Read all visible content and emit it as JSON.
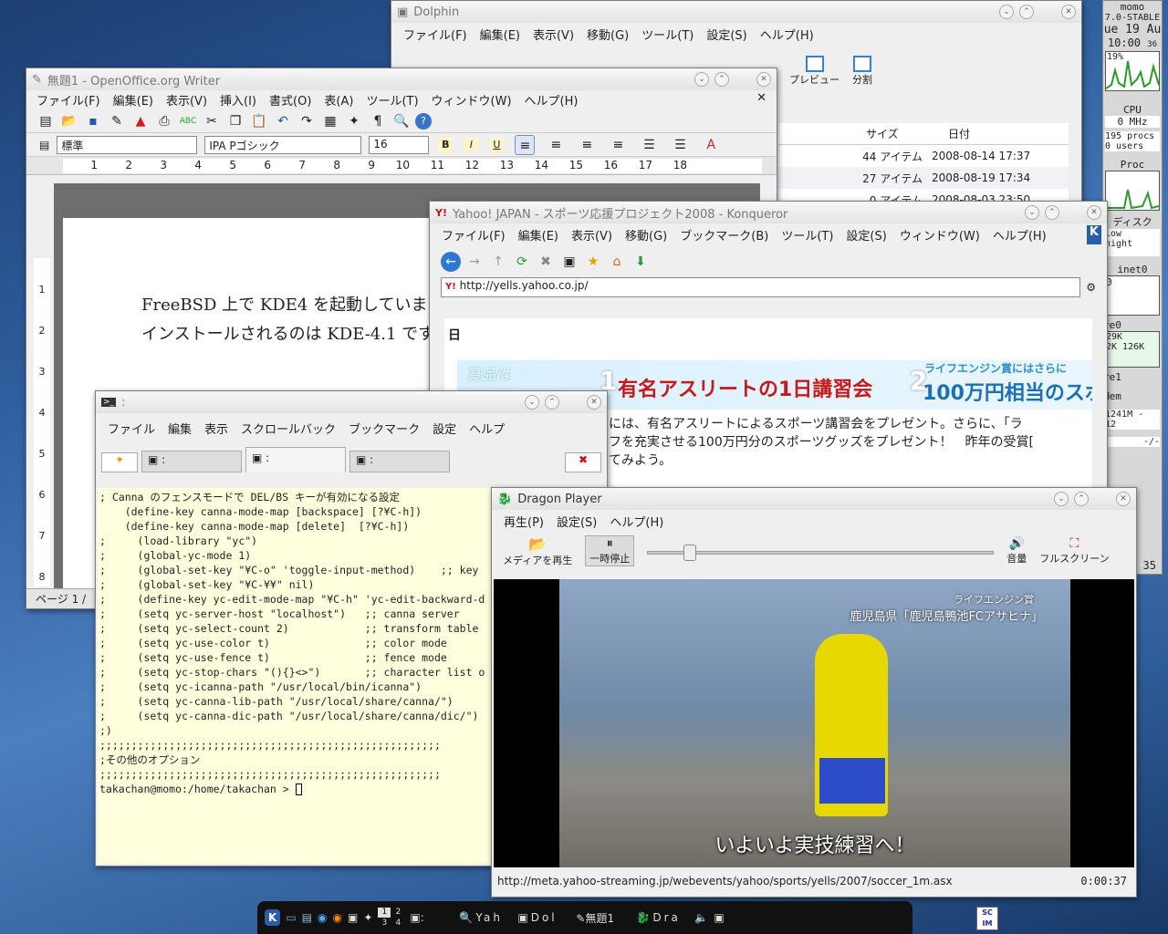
{
  "dolphin": {
    "title": "Dolphin",
    "menu": [
      "ファイル(F)",
      "編集(E)",
      "表示(V)",
      "移動(G)",
      "ツール(T)",
      "設定(S)",
      "ヘルプ(H)"
    ],
    "tools": [
      "プレビュー",
      "分割"
    ],
    "col_size": "サイズ",
    "col_date": "日付",
    "rows": [
      {
        "size": "44 アイテム",
        "date": "2008-08-14 17:37"
      },
      {
        "size": "27 アイテム",
        "date": "2008-08-19 17:34"
      },
      {
        "size": "0 アイテム",
        "date": "2008-08-03 23:50"
      }
    ]
  },
  "writer": {
    "title": "無題1 - OpenOffice.org Writer",
    "menu": [
      "ファイル(F)",
      "編集(E)",
      "表示(V)",
      "挿入(I)",
      "書式(O)",
      "表(A)",
      "ツール(T)",
      "ウィンドウ(W)",
      "ヘルプ(H)"
    ],
    "style": "標準",
    "font": "IPA Pゴシック",
    "size": "16",
    "ruler": [
      "1",
      "2",
      "3",
      "4",
      "5",
      "6",
      "7",
      "8",
      "9",
      "10",
      "11",
      "12",
      "13",
      "14",
      "15",
      "16",
      "17",
      "18"
    ],
    "vruler": [
      "1",
      "2",
      "3",
      "4",
      "5",
      "6",
      "7",
      "8"
    ],
    "line1": "FreeBSD 上で KDE4 を起動していま",
    "line2": "インストールされるのは KDE-4.1 です",
    "status": "ページ 1 /"
  },
  "konqueror": {
    "title": "Yahoo! JAPAN - スポーツ応援プロジェクト2008 - Konqueror",
    "menu": [
      "ファイル(F)",
      "編集(E)",
      "表示(V)",
      "移動(G)",
      "ブックマーク(B)",
      "ツール(T)",
      "設定(S)",
      "ウィンドウ(W)",
      "ヘルプ(H)"
    ],
    "url": "http://yells.yahoo.co.jp/",
    "day": "日",
    "banner_left": "賞品は",
    "banner_num1": "1",
    "banner_main": "有名アスリートの1日講習会",
    "banner_num2": "2",
    "banner_small": "ライフエンジン賞にはさらに",
    "banner_right": "100万円相当のスポ",
    "body1": "には、有名アスリートによるスポーツ講習会をプレゼント。さらに、「ラ",
    "body2": "フを充実させる100万円分のスポーツグッズをプレゼント！　昨年の受賞[",
    "body3": "てみよう。"
  },
  "konsole": {
    "title": ":",
    "menu": [
      "ファイル",
      "編集",
      "表示",
      "スクロールバック",
      "ブックマーク",
      "設定",
      "ヘルプ"
    ],
    "tabs": [
      ":",
      ":",
      ":"
    ],
    "lines": [
      "; Canna のフェンスモードで DEL/BS キーが有効になる設定",
      "    (define-key canna-mode-map [backspace] [?¥C-h])",
      "    (define-key canna-mode-map [delete]  [?¥C-h])",
      "",
      ";     (load-library \"yc\")",
      ";     (global-yc-mode 1)",
      ";     (global-set-key \"¥C-o\" 'toggle-input-method)    ;; key",
      ";     (global-set-key \"¥C-¥¥\" nil)",
      ";     (define-key yc-edit-mode-map \"¥C-h\" 'yc-edit-backward-d",
      ";     (setq yc-server-host \"localhost\")   ;; canna server",
      ";     (setq yc-select-count 2)            ;; transform table",
      ";     (setq yc-use-color t)               ;; color mode",
      ";     (setq yc-use-fence t)               ;; fence mode",
      ";     (setq yc-stop-chars \"(){}<>\")       ;; character list o",
      "",
      ";     (setq yc-icanna-path \"/usr/local/bin/icanna\")",
      ";     (setq yc-canna-lib-path \"/usr/local/share/canna/\")",
      ";     (setq yc-canna-dic-path \"/usr/local/share/canna/dic/\")",
      ";)",
      "",
      "",
      ";;;;;;;;;;;;;;;;;;;;;;;;;;;;;;;;;;;;;;;;;;;;;;;;;;;;;;",
      ";その他のオプション",
      ";;;;;;;;;;;;;;;;;;;;;;;;;;;;;;;;;;;;;;;;;;;;;;;;;;;;;;"
    ],
    "prompt": "takachan@momo:/home/takachan > "
  },
  "dragon": {
    "title": "Dragon Player",
    "menu": [
      "再生(P)",
      "設定(S)",
      "ヘルプ(H)"
    ],
    "play_media": "メディアを再生",
    "pause": "一時停止",
    "volume": "音量",
    "fullscreen": "フルスクリーン",
    "caption_top1": "ライフエンジン賞",
    "caption_top2": "鹿児島県「鹿児島鴨池FCアサヒナ」",
    "subtitle": "いよいよ実技練習へ！",
    "url": "http://meta.yahoo-streaming.jp/webevents/yahoo/sports/yells/2007/soccer_1m.asx",
    "time": "0:00:37",
    "progress": 0.12
  },
  "monitor": {
    "host": "momo",
    "os": "7.0-STABLE",
    "date": "ue 19 Au",
    "time": "10:00",
    "sec": "36",
    "cpu_pct": "19%",
    "cpu": "CPU",
    "mhz": "0 MHz",
    "procs": "195 procs",
    "users": "0 users",
    "proc": "Proc",
    "disk": "ディスク",
    "low": "low",
    "high": "hight",
    "inet": "inet0",
    "zero": "0",
    "re0": "re0",
    "k1": "29K",
    "k2": "2K 126K",
    "re1": "re1",
    "mem": "Mem",
    "m1": "1241M - 12",
    "m2": "-/-",
    "clock": "35"
  },
  "taskbar": {
    "pager": [
      "1",
      "2",
      "3",
      "4"
    ],
    "tasks": [
      ":",
      "Yah",
      "Dol",
      "無題1",
      "Dra"
    ]
  }
}
